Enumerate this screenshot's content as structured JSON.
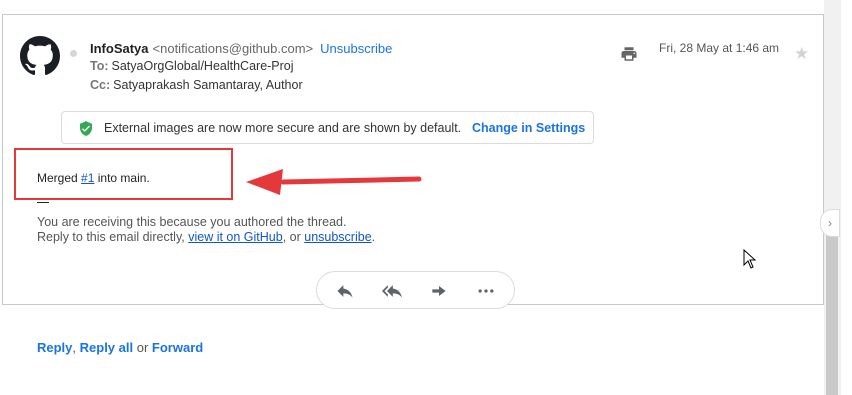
{
  "header": {
    "sender_name": "InfoSatya",
    "sender_email": "<notifications@github.com>",
    "unsubscribe_label": "Unsubscribe",
    "to_label": "To:",
    "to_value": "SatyaOrgGlobal/HealthCare-Proj",
    "cc_label": "Cc:",
    "cc_value": "Satyaprakash Samantaray,  Author",
    "date": "Fri, 28 May at 1:46 am"
  },
  "notice": {
    "text": "External images are now more secure and are shown by default.",
    "link": "Change in Settings"
  },
  "body": {
    "merged_prefix": "Merged ",
    "issue_link": "#1",
    "merged_suffix": " into main.",
    "dash": "—",
    "footer_line1": "You are receiving this because you authored the thread.",
    "footer_line2_prefix": "Reply to this email directly, ",
    "view_link": "view it on GitHub",
    "footer_mid": ", or ",
    "unsubscribe_link": "unsubscribe",
    "footer_end": "."
  },
  "reply_bar": {
    "reply": "Reply",
    "sep1": ", ",
    "reply_all": "Reply all",
    "sep2": " or ",
    "forward": "Forward"
  },
  "icons": {
    "avatar": "github-logo-icon",
    "print": "print-icon",
    "star": "star-icon",
    "shield": "shield-check-icon",
    "reply": "reply-icon",
    "reply_all": "reply-all-icon",
    "forward": "forward-icon",
    "more": "more-icon",
    "side_handle": "chevron-right-icon"
  },
  "colors": {
    "link": "#1a73e8",
    "annotation": "#e5383b",
    "shield": "#34a853"
  }
}
